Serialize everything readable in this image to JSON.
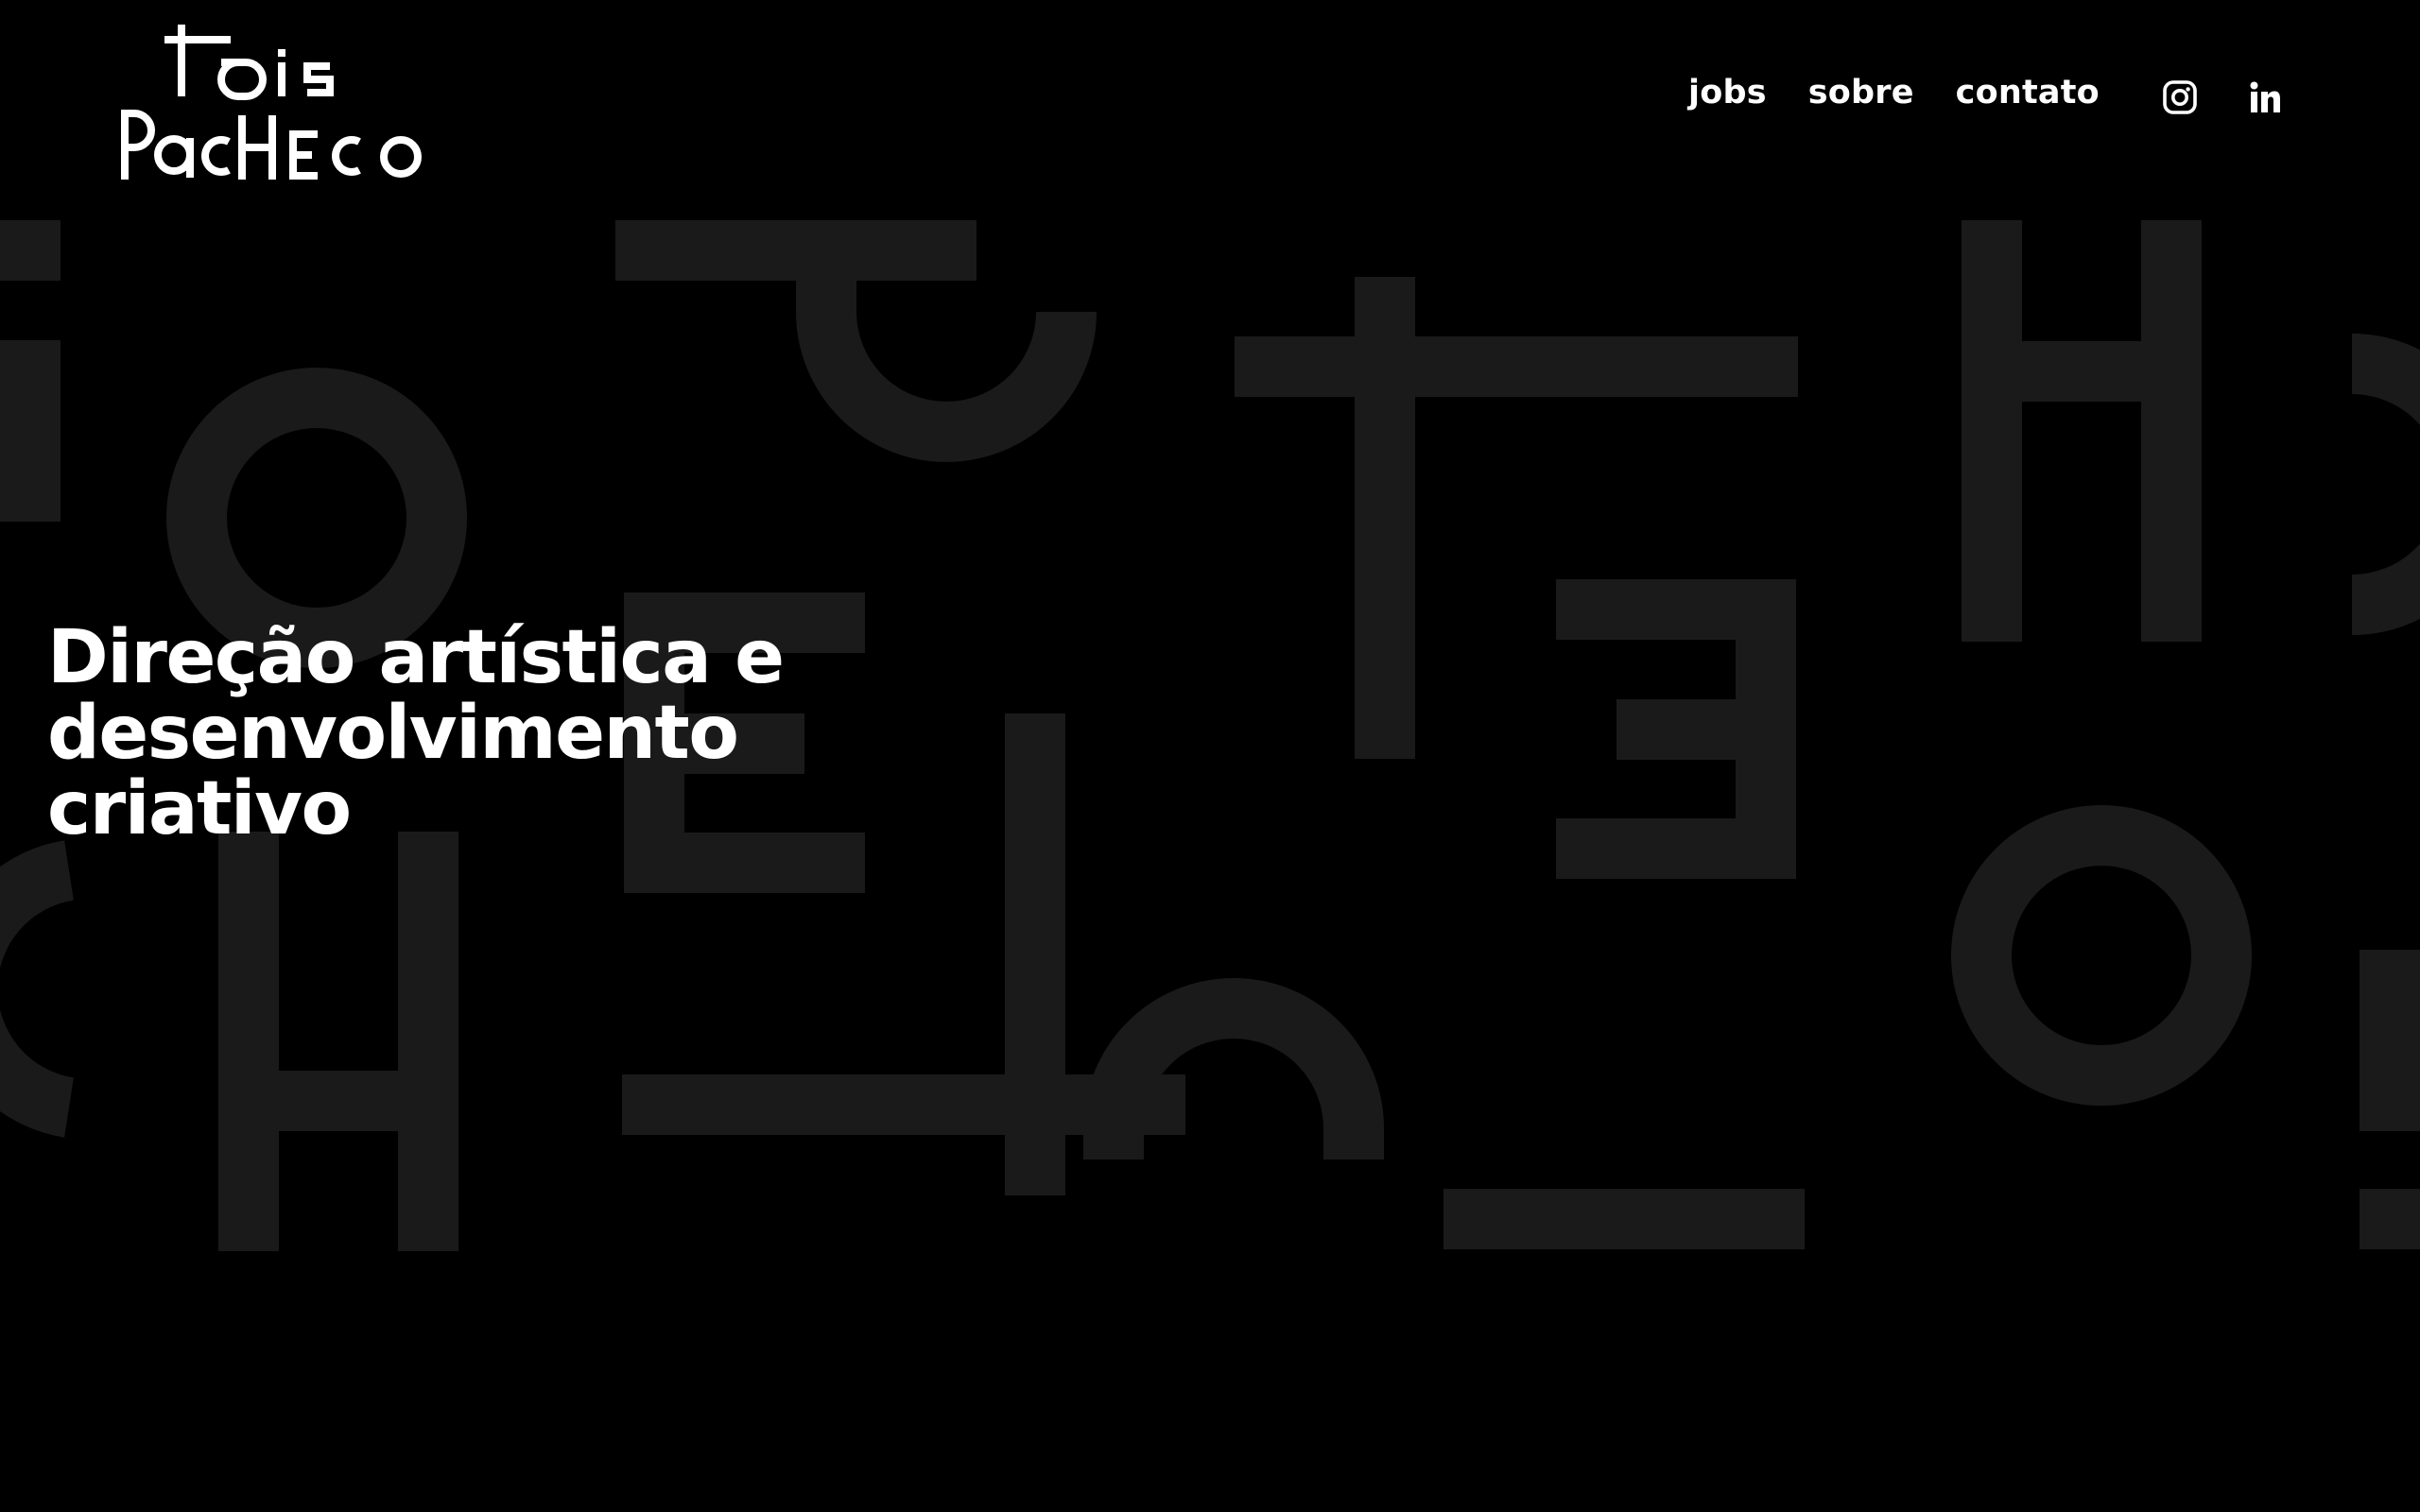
{
  "brand": {
    "name": "Tais Pacheco",
    "logo_line_1": "Tais",
    "logo_line_2": "Pacheco"
  },
  "nav": {
    "items": [
      {
        "id": "jobs",
        "label": "jobs"
      },
      {
        "id": "sobre",
        "label": "sobre"
      },
      {
        "id": "contato",
        "label": "contato"
      }
    ]
  },
  "social": {
    "items": [
      {
        "id": "instagram",
        "icon": "instagram-icon"
      },
      {
        "id": "linkedin",
        "icon": "linkedin-icon"
      }
    ]
  },
  "hero": {
    "line_1": "Direção artística e",
    "line_2": "desenvolvimento",
    "line_3": "criativo"
  },
  "colors": {
    "background": "#000000",
    "text": "#ffffff",
    "decorative_glyphs": "#1a1a1a"
  }
}
